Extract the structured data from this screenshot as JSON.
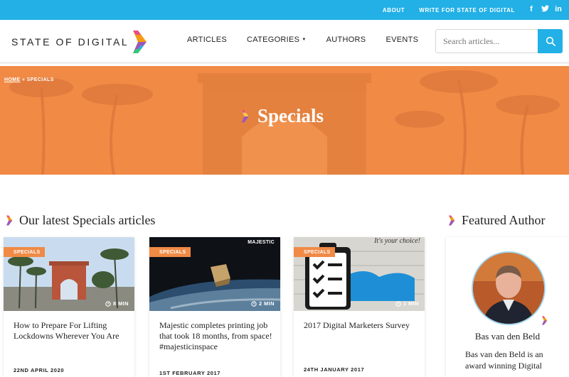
{
  "topbar": {
    "links": [
      "ABOUT",
      "WRITE FOR STATE OF DIGITAL"
    ],
    "social": [
      "facebook-icon",
      "twitter-icon",
      "linkedin-icon"
    ],
    "color": "#22b0e6"
  },
  "header": {
    "logo_text": "STATE OF DIGITAL",
    "nav": [
      "ARTICLES",
      "CATEGORIES",
      "AUTHORS",
      "EVENTS"
    ],
    "search_placeholder": "Search articles..."
  },
  "hero": {
    "breadcrumb_home": "HOME",
    "breadcrumb_sep": " » ",
    "breadcrumb_current": "SPECIALS",
    "title": "Specials",
    "color": "#f08a45"
  },
  "latest": {
    "heading": "Our latest Specials articles",
    "cards": [
      {
        "badge": "SPECIALS",
        "minutes": "8 MIN",
        "title": "How to Prepare For Lifting Lockdowns Wherever You Are",
        "date": "22ND APRIL 2020"
      },
      {
        "badge": "SPECIALS",
        "minutes": "2 MIN",
        "title": "Majestic completes printing job that took 18 months, from space! #majesticinspace",
        "date": "1ST FEBRUARY 2017",
        "image_caption": "MAJESTIC"
      },
      {
        "badge": "SPECIALS",
        "minutes": "1 MIN",
        "title": "2017 Digital Marketers Survey",
        "date": "24TH JANUARY 2017",
        "image_caption": "It's your choice!"
      }
    ]
  },
  "featured": {
    "heading": "Featured Author",
    "name": "Bas van den Beld",
    "bio": "Bas van den Beld is an award winning Digital"
  }
}
